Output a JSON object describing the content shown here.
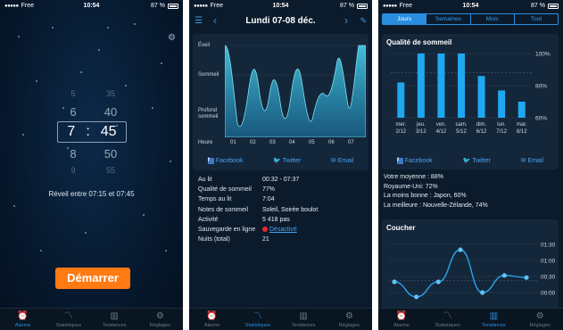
{
  "status": {
    "carrier": "Free",
    "time": "10:54",
    "battery": "87 %"
  },
  "tabs": [
    {
      "label": "Alarme",
      "icon": "alarm-clock-icon"
    },
    {
      "label": "Statistiques",
      "icon": "line-chart-icon"
    },
    {
      "label": "Tendances",
      "icon": "bar-chart-icon"
    },
    {
      "label": "Réglages",
      "icon": "gear-icon"
    }
  ],
  "alarm": {
    "hours": [
      "5",
      "6",
      "7",
      "8",
      "9"
    ],
    "minutes": [
      "35",
      "40",
      "45",
      "50",
      "55"
    ],
    "selected_hour": "7",
    "selected_minute": "45",
    "separator": ":",
    "wake_text": "Réveil entre 07:15 et 07:45",
    "start_button": "Démarrer"
  },
  "stats_screen": {
    "date_title": "Lundi 07-08 déc.",
    "graph": {
      "y_labels": [
        "Éveil",
        "Sommeil",
        "Profond sommeil"
      ],
      "x_title": "Heure",
      "x_labels": [
        "01",
        "02",
        "03",
        "04",
        "05",
        "06",
        "07"
      ]
    },
    "share": {
      "facebook": "Facebook",
      "twitter": "Twitter",
      "email": "Email"
    },
    "details": [
      {
        "key": "Au lit",
        "value": "00:32 - 07:37"
      },
      {
        "key": "Qualité de sommeil",
        "value": "77%"
      },
      {
        "key": "Temps au lit",
        "value": "7:04"
      },
      {
        "key": "Notes de sommeil",
        "value": "Soleil, Soirée boulot"
      },
      {
        "key": "Activité",
        "value": "5 418 pas"
      },
      {
        "key": "Sauvegarde en ligne",
        "value": "Désactivé"
      },
      {
        "key": "Nuits (total)",
        "value": "21"
      }
    ]
  },
  "trends_screen": {
    "segments": [
      "Jours",
      "Semaines",
      "Mois",
      "Tout"
    ],
    "quality_title": "Qualité de sommeil",
    "couch_title": "Coucher",
    "stats": [
      "Votre moyenne : 88%",
      "Royaume-Uni: 72%",
      "La moins bonne : Japon, 60%",
      "La meilleure : Nouvelle-Zélande, 74%"
    ]
  },
  "colors": {
    "accent": "#2a8ee0",
    "start": "#ff7a12",
    "graph_fill": "#3fb9d8",
    "bar": "#1fa8f0"
  },
  "chart_data": [
    {
      "type": "area",
      "x": [
        "01",
        "02",
        "03",
        "04",
        "05",
        "06",
        "07"
      ],
      "ylabels": [
        "Éveil",
        "Sommeil",
        "Profond sommeil"
      ],
      "xlabel": "Heure"
    },
    {
      "type": "bar",
      "title": "Qualité de sommeil",
      "categories": [
        "mer. 2/12",
        "jeu. 3/12",
        "ven. 4/12",
        "sam. 5/12",
        "dim. 6/12",
        "lun. 7/12",
        "mar. 8/12"
      ],
      "values": [
        82,
        100,
        100,
        100,
        86,
        77,
        70
      ],
      "ylim": [
        60,
        100
      ],
      "yticks": [
        "100%",
        "80%",
        "60%"
      ]
    },
    {
      "type": "line",
      "title": "Coucher",
      "yticks": [
        "01:30",
        "01:00",
        "00:30",
        "00:00"
      ],
      "values": [
        "00:20",
        "23:52",
        "00:20",
        "01:20",
        "00:00",
        "00:32",
        "00:28"
      ]
    }
  ]
}
